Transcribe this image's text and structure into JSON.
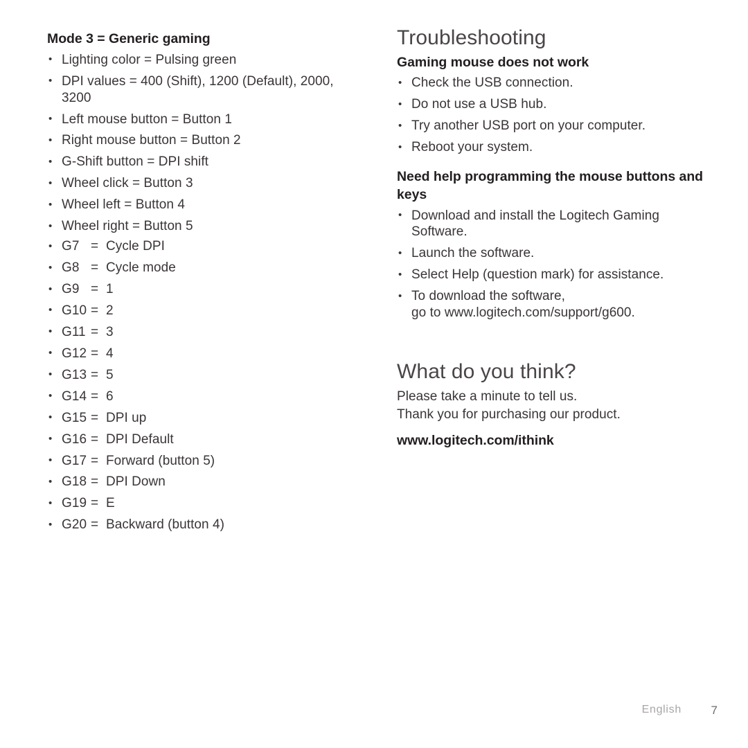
{
  "page": {
    "language": "English",
    "page_number": "7"
  },
  "left_column": {
    "heading": "Mode 3 = Generic gaming",
    "bullets": [
      "Lighting color = Pulsing green",
      "DPI values = 400 (Shift), 1200 (Default), 2000, 3200",
      "Left mouse button = Button 1",
      "Right mouse button = Button 2",
      "G-Shift button = DPI shift",
      "Wheel click = Button 3",
      "Wheel left = Button 4",
      "Wheel right = Button 5"
    ],
    "key_assignments": [
      {
        "key": "G7",
        "eq": "=",
        "value": "Cycle DPI"
      },
      {
        "key": "G8",
        "eq": "=",
        "value": "Cycle mode"
      },
      {
        "key": "G9",
        "eq": "=",
        "value": "1"
      },
      {
        "key": "G10",
        "eq": "=",
        "value": "2"
      },
      {
        "key": "G11",
        "eq": "=",
        "value": "3"
      },
      {
        "key": "G12",
        "eq": "=",
        "value": "4"
      },
      {
        "key": "G13",
        "eq": "=",
        "value": "5"
      },
      {
        "key": "G14",
        "eq": "=",
        "value": "6"
      },
      {
        "key": "G15",
        "eq": "=",
        "value": "DPI up"
      },
      {
        "key": "G16",
        "eq": "=",
        "value": "DPI Default"
      },
      {
        "key": "G17",
        "eq": "=",
        "value": "Forward (button 5)"
      },
      {
        "key": "G18",
        "eq": "=",
        "value": "DPI Down"
      },
      {
        "key": "G19",
        "eq": "=",
        "value": "E"
      },
      {
        "key": "G20",
        "eq": "=",
        "value": "Backward (button 4)"
      }
    ]
  },
  "right_column": {
    "troubleshooting": {
      "heading": "Troubleshooting",
      "section_one": {
        "heading": "Gaming mouse does not work",
        "bullets": [
          "Check the USB connection.",
          "Do not use a USB hub.",
          "Try another USB port on your computer.",
          "Reboot your system."
        ]
      },
      "section_two": {
        "heading": "Need help programming the mouse buttons and keys",
        "bullets": [
          "Download and install the Logitech Gaming Software.",
          "Launch the software.",
          "Select Help (question mark) for assistance.",
          "To download the software,\ngo to www.logitech.com/support/g600."
        ]
      }
    },
    "feedback": {
      "heading": "What do you think?",
      "line_one": "Please take a minute to tell us.",
      "line_two": "Thank you for purchasing our product.",
      "url": "www.logitech.com/ithink"
    }
  }
}
